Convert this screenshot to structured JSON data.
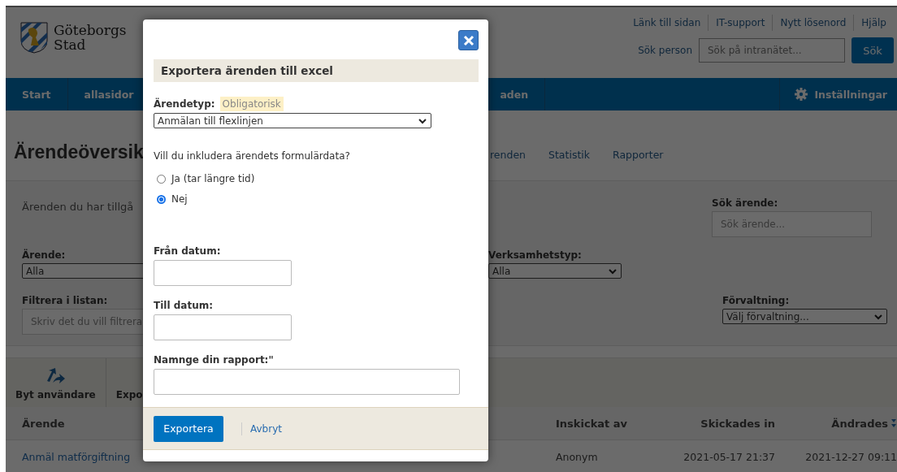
{
  "header": {
    "logo_lines": [
      "Göteborgs",
      "Stad"
    ],
    "top_links": [
      "Länk till sidan",
      "IT-support",
      "Nytt lösenord",
      "Hjälp"
    ],
    "person_search": {
      "label": "Sök person",
      "placeholder": "Sök på intranätet...",
      "button": "Sök"
    }
  },
  "nav": {
    "items": [
      "Start",
      "allasidor",
      "aden"
    ],
    "settings": "Inställningar"
  },
  "page_title": "Ärendeöversik",
  "tabs": [
    "renden",
    "Statistik",
    "Rapporter"
  ],
  "filters": {
    "intro": "Ärenden du har tillgå",
    "case_search": {
      "label": "Sök ärende:",
      "placeholder": "Sök ärende..."
    },
    "case_type": {
      "label": "Ärende:",
      "value": "Alla"
    },
    "business_type": {
      "label": "Verksamhetstyp:",
      "value": "Alla"
    },
    "list_filter": {
      "label": "Filtrera i listan:",
      "placeholder": "Skriv det du vill filtrera"
    },
    "administration": {
      "label": "Förvaltning:",
      "value": "Välj förvaltning..."
    }
  },
  "toolbar": [
    {
      "label": "Byt användare",
      "kind": "icon"
    },
    {
      "label": "Expo",
      "kind": "text"
    }
  ],
  "table": {
    "columns": [
      {
        "label": "Ärende",
        "sorted": false
      },
      {
        "label": "Inskickat av",
        "sorted": false
      },
      {
        "label": "Skickades in",
        "sorted": false
      },
      {
        "label": "Ändrades",
        "sorted": true
      }
    ],
    "rows": [
      [
        "Anmäl matförgiftning",
        "Anonym",
        "2021-05-17 21:37",
        "2021-12-27 09:11"
      ]
    ]
  },
  "dialog": {
    "title": "Exportera ärenden till excel",
    "type_label": "Ärendetyp:",
    "type_badge": "Obligatorisk",
    "type_value": "Anmälan till flexlinjen",
    "question": "Vill du inkludera ärendets formulärdata?",
    "options": [
      {
        "label": "Ja (tar längre tid)",
        "selected": false
      },
      {
        "label": "Nej",
        "selected": true
      }
    ],
    "fields": [
      {
        "label": "Från datum:",
        "kind": "date"
      },
      {
        "label": "Till datum:",
        "kind": "date"
      },
      {
        "label": "Namnge din rapport:\"",
        "kind": "text"
      }
    ],
    "submit": "Exportera",
    "cancel": "Avbryt"
  }
}
